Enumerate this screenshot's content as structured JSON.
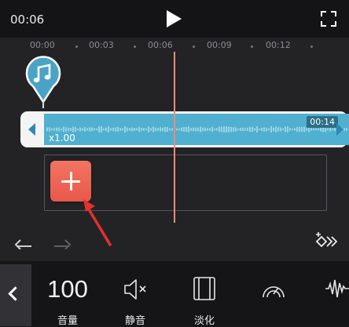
{
  "player": {
    "current_time": "00:06"
  },
  "timeline": {
    "ticks": [
      "00:00",
      "00:03",
      "00:06",
      "00:09",
      "00:12"
    ],
    "clip": {
      "duration": "00:14",
      "speed": "x1.00"
    }
  },
  "toolbar": {
    "volume_value": "100",
    "volume_label": "音量",
    "mute_label": "静音",
    "fade_label": "淡化"
  },
  "colors": {
    "accent": "#f0695a",
    "clip": "#4fb0cf",
    "playhead": "#f28b79",
    "background": "#232326"
  },
  "icons": [
    "play-icon",
    "fullscreen-icon",
    "music-note-icon",
    "plus-icon",
    "undo-icon",
    "redo-icon",
    "keyframe-icon",
    "chevron-left-icon",
    "mute-icon",
    "fade-icon",
    "speed-icon",
    "voice-effect-icon"
  ]
}
